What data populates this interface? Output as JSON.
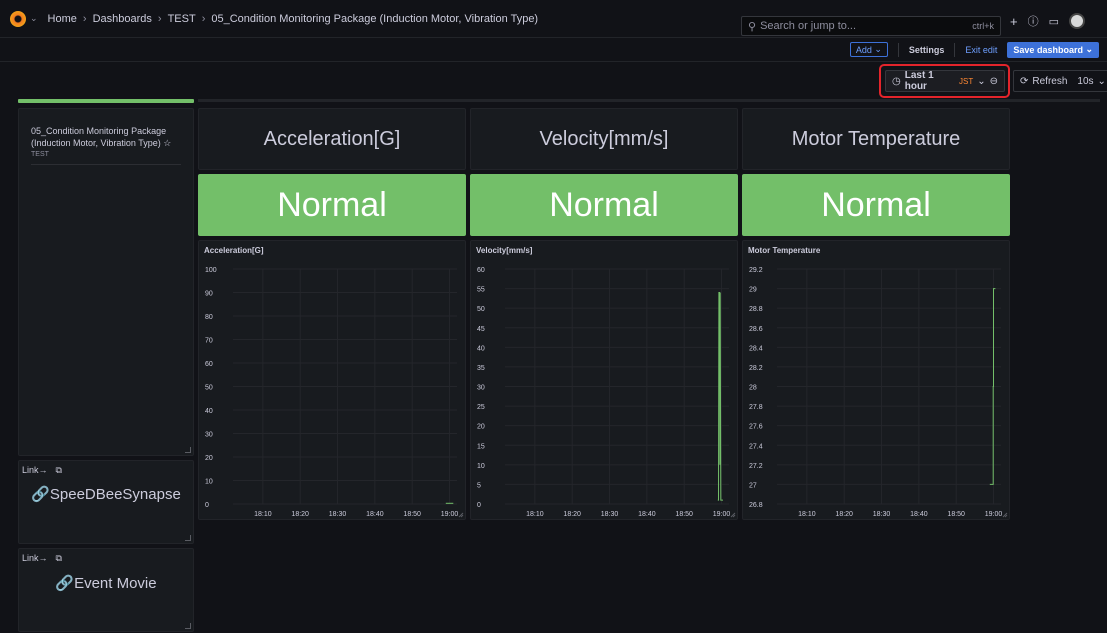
{
  "breadcrumb": {
    "items": [
      "Home",
      "Dashboards",
      "TEST",
      "05_Condition Monitoring Package (Induction Motor, Vibration Type)"
    ]
  },
  "search": {
    "placeholder": "Search or jump to...",
    "shortcut": "ctrl+k"
  },
  "edit_bar": {
    "add": "Add",
    "settings": "Settings",
    "exit_edit": "Exit edit",
    "save": "Save dashboard"
  },
  "time": {
    "range": "Last 1 hour",
    "tz": "JST",
    "refresh": "Refresh",
    "interval": "10s"
  },
  "text_panel": {
    "title": "05_Condition Monitoring Package (Induction Motor, Vibration Type)",
    "subtitle": "TEST"
  },
  "link_panels": [
    {
      "title": "Link→",
      "link": "SpeeDBeeSynapse"
    },
    {
      "title": "Link→",
      "link": "Event Movie"
    }
  ],
  "title_panels": [
    "Acceleration[G]",
    "Velocity[mm/s]",
    "Motor Temperature"
  ],
  "stat_panels": [
    "Normal",
    "Normal",
    "Normal"
  ],
  "colors": {
    "accent": "#3d71d9",
    "ok": "#73bf69",
    "highlight": "#e3242b",
    "line": "#73bf69"
  },
  "chart_data": [
    {
      "type": "line",
      "title": "Acceleration[G]",
      "x_ticks": [
        "18:10",
        "18:20",
        "18:30",
        "18:40",
        "18:50",
        "19:00"
      ],
      "y_ticks": [
        "100",
        "90",
        "80",
        "70",
        "60",
        "50",
        "40",
        "30",
        "20",
        "10",
        "0"
      ],
      "ylim": [
        0,
        100
      ],
      "xlim": [
        "18:02",
        "19:02"
      ],
      "series": [
        {
          "points": [
            [
              "18:59",
              0.3
            ],
            [
              "19:01",
              0.3
            ]
          ]
        }
      ]
    },
    {
      "type": "line",
      "title": "Velocity[mm/s]",
      "x_ticks": [
        "18:10",
        "18:20",
        "18:30",
        "18:40",
        "18:50",
        "19:00"
      ],
      "y_ticks": [
        "60",
        "55",
        "50",
        "45",
        "40",
        "35",
        "30",
        "25",
        "20",
        "15",
        "10",
        "5",
        "0"
      ],
      "ylim": [
        0,
        60
      ],
      "xlim": [
        "18:02",
        "19:02"
      ],
      "series": [
        {
          "points": [
            [
              "18:59.0",
              1
            ],
            [
              "18:59.2",
              1
            ],
            [
              "18:59.3",
              54
            ],
            [
              "18:59.45",
              54
            ],
            [
              "18:59.55",
              10
            ],
            [
              "18:59.65",
              54
            ],
            [
              "18:59.8",
              1
            ],
            [
              "19:00.4",
              1
            ]
          ]
        }
      ]
    },
    {
      "type": "line",
      "title": "Motor Temperature",
      "x_ticks": [
        "18:10",
        "18:20",
        "18:30",
        "18:40",
        "18:50",
        "19:00"
      ],
      "y_ticks": [
        "29.2",
        "29",
        "28.8",
        "28.6",
        "28.4",
        "28.2",
        "28",
        "27.8",
        "27.6",
        "27.4",
        "27.2",
        "27",
        "26.8"
      ],
      "ylim": [
        26.8,
        29.2
      ],
      "xlim": [
        "18:02",
        "19:02"
      ],
      "series": [
        {
          "points": [
            [
              "18:59.0",
              27
            ],
            [
              "18:59.9",
              27
            ],
            [
              "18:59.9",
              28
            ],
            [
              "19:00.0",
              28
            ],
            [
              "19:00.0",
              29
            ],
            [
              "19:00.5",
              29
            ]
          ]
        }
      ]
    }
  ]
}
